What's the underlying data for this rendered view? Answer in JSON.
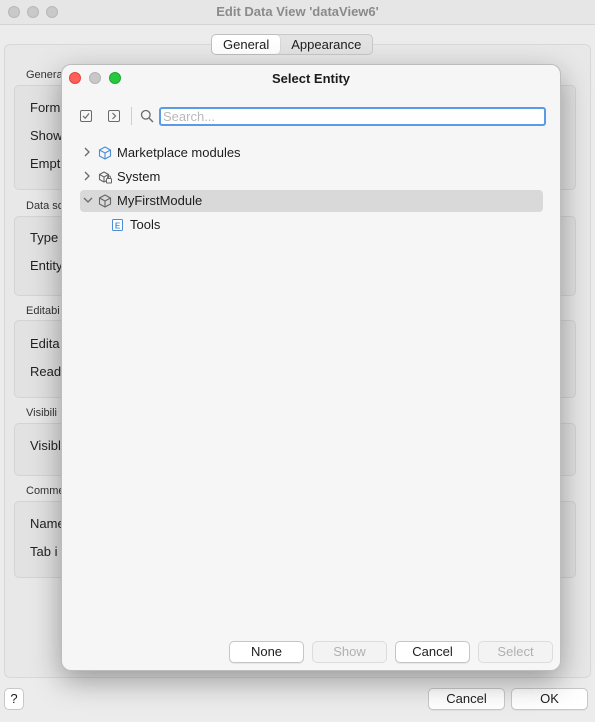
{
  "window": {
    "title": "Edit Data View 'dataView6'",
    "tabs": [
      {
        "label": "General",
        "selected": true
      },
      {
        "label": "Appearance",
        "selected": false
      }
    ]
  },
  "background_form": {
    "groups": [
      {
        "label": "Genera",
        "fields": [
          "Form",
          "Show",
          "Empt"
        ]
      },
      {
        "label": "Data so",
        "fields": [
          "Type",
          "Entity"
        ]
      },
      {
        "label": "Editabi",
        "fields": [
          "Edita",
          "Read"
        ]
      },
      {
        "label": "Visibili",
        "fields": [
          "Visibl"
        ]
      },
      {
        "label": "Comme",
        "fields": [
          "Name",
          "Tab i"
        ]
      }
    ]
  },
  "footer": {
    "help_label": "?",
    "cancel_label": "Cancel",
    "ok_label": "OK"
  },
  "dialog": {
    "title": "Select Entity",
    "search": {
      "value": "",
      "placeholder": "Search..."
    },
    "toolbar_icons": [
      "collapse-all-icon",
      "expand-all-icon",
      "search-icon"
    ],
    "tree": [
      {
        "label": "Marketplace modules",
        "icon": "module-icon",
        "expanded": false,
        "selected": false,
        "level": 0
      },
      {
        "label": "System",
        "icon": "system-module-icon",
        "expanded": false,
        "selected": false,
        "level": 0
      },
      {
        "label": "MyFirstModule",
        "icon": "module-icon",
        "expanded": true,
        "selected": true,
        "level": 0
      },
      {
        "label": "Tools",
        "icon": "entity-icon",
        "glyph": "E",
        "expanded": false,
        "selected": false,
        "level": 1
      }
    ],
    "buttons": [
      {
        "label": "None",
        "enabled": true
      },
      {
        "label": "Show",
        "enabled": false
      },
      {
        "label": "Cancel",
        "enabled": true
      },
      {
        "label": "Select",
        "enabled": false
      }
    ]
  },
  "colors": {
    "accent": "#5b9ae6",
    "close": "#ff5f57",
    "minimize": "#c8c8c8",
    "zoom": "#28c840",
    "module_icon": "#4a8fd6"
  }
}
